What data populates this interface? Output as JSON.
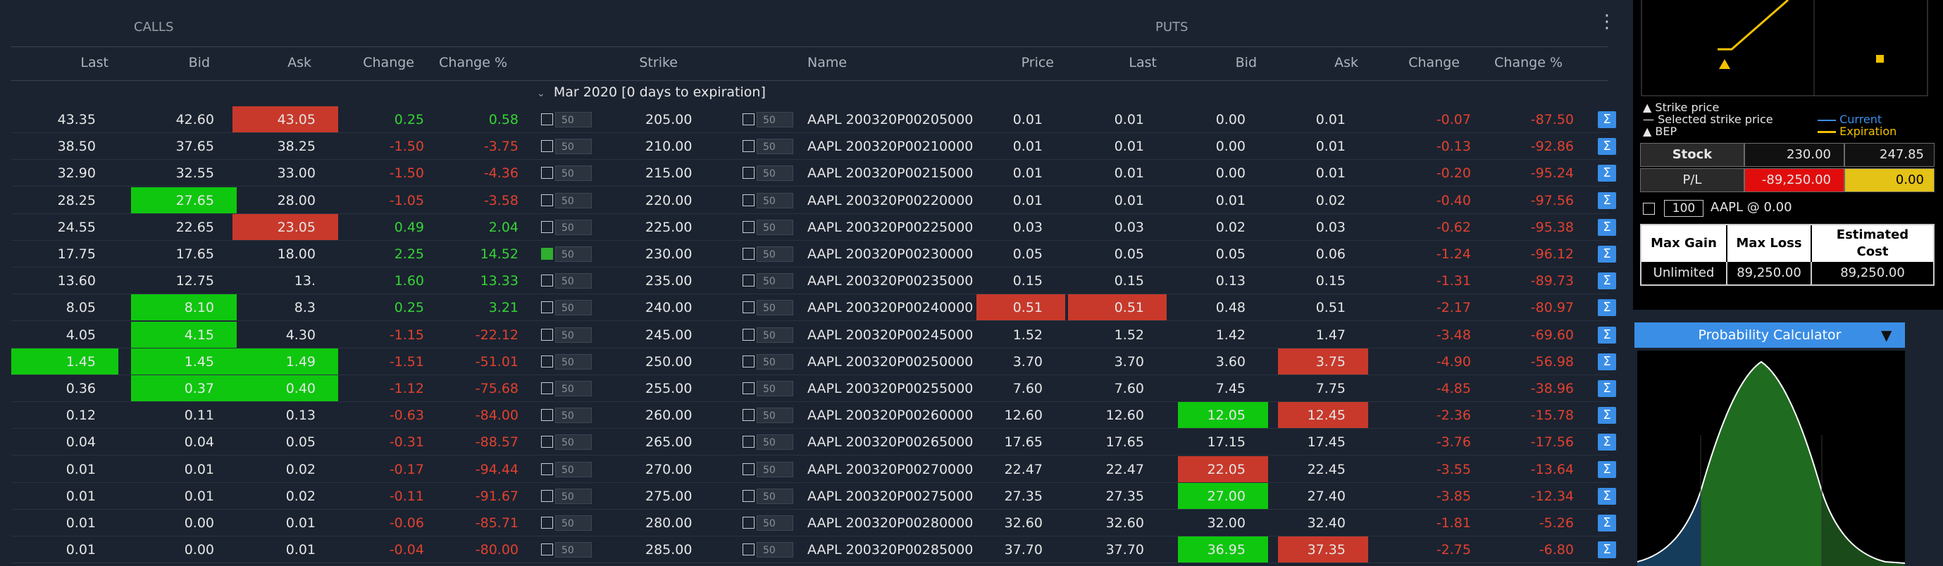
{
  "sections": {
    "calls": "CALLS",
    "puts": "PUTS"
  },
  "headers": {
    "calls_last": "Last",
    "calls_bid": "Bid",
    "calls_ask": "Ask",
    "calls_change": "Change",
    "calls_change_pct": "Change %",
    "strike": "Strike",
    "name": "Name",
    "price": "Price",
    "puts_last": "Last",
    "puts_bid": "Bid",
    "puts_ask": "Ask",
    "puts_change": "Change",
    "puts_change_pct": "Change %"
  },
  "expiry_group": "Mar 2020 [0 days to expiration]",
  "qty_default": "50",
  "sigma": "Σ",
  "rows": [
    {
      "c_last": "43.35",
      "c_bid": "42.60",
      "c_ask": "43.05",
      "c_chg": "0.25",
      "c_chgp": "0.58",
      "strike": "205.00",
      "name": "AAPL 200320P00205000",
      "price": "0.01",
      "p_last": "0.01",
      "p_bid": "0.00",
      "p_ask": "0.01",
      "p_chg": "-0.07",
      "p_chgp": "-87.50"
    },
    {
      "c_last": "38.50",
      "c_bid": "37.65",
      "c_ask": "38.25",
      "c_chg": "-1.50",
      "c_chgp": "-3.75",
      "strike": "210.00",
      "name": "AAPL 200320P00210000",
      "price": "0.01",
      "p_last": "0.01",
      "p_bid": "0.00",
      "p_ask": "0.01",
      "p_chg": "-0.13",
      "p_chgp": "-92.86"
    },
    {
      "c_last": "32.90",
      "c_bid": "32.55",
      "c_ask": "33.00",
      "c_chg": "-1.50",
      "c_chgp": "-4.36",
      "strike": "215.00",
      "name": "AAPL 200320P00215000",
      "price": "0.01",
      "p_last": "0.01",
      "p_bid": "0.00",
      "p_ask": "0.01",
      "p_chg": "-0.20",
      "p_chgp": "-95.24"
    },
    {
      "c_last": "28.25",
      "c_bid": "27.65",
      "c_ask": "28.00",
      "c_chg": "-1.05",
      "c_chgp": "-3.58",
      "strike": "220.00",
      "name": "AAPL 200320P00220000",
      "price": "0.01",
      "p_last": "0.01",
      "p_bid": "0.01",
      "p_ask": "0.02",
      "p_chg": "-0.40",
      "p_chgp": "-97.56"
    },
    {
      "c_last": "24.55",
      "c_bid": "22.65",
      "c_ask": "23.05",
      "c_chg": "0.49",
      "c_chgp": "2.04",
      "strike": "225.00",
      "name": "AAPL 200320P00225000",
      "price": "0.03",
      "p_last": "0.03",
      "p_bid": "0.02",
      "p_ask": "0.03",
      "p_chg": "-0.62",
      "p_chgp": "-95.38"
    },
    {
      "c_last": "17.75",
      "c_bid": "17.65",
      "c_ask": "18.00",
      "c_chg": "2.25",
      "c_chgp": "14.52",
      "strike": "230.00",
      "name": "AAPL 200320P00230000",
      "price": "0.05",
      "p_last": "0.05",
      "p_bid": "0.05",
      "p_ask": "0.06",
      "p_chg": "-1.24",
      "p_chgp": "-96.12"
    },
    {
      "c_last": "13.60",
      "c_bid": "12.75",
      "c_ask": "13.",
      "c_chg": "1.60",
      "c_chgp": "13.33",
      "strike": "235.00",
      "name": "AAPL 200320P00235000",
      "price": "0.15",
      "p_last": "0.15",
      "p_bid": "0.13",
      "p_ask": "0.15",
      "p_chg": "-1.31",
      "p_chgp": "-89.73"
    },
    {
      "c_last": "8.05",
      "c_bid": "8.10",
      "c_ask": "8.3",
      "c_chg": "0.25",
      "c_chgp": "3.21",
      "strike": "240.00",
      "name": "AAPL 200320P00240000",
      "price": "0.51",
      "p_last": "0.51",
      "p_bid": "0.48",
      "p_ask": "0.51",
      "p_chg": "-2.17",
      "p_chgp": "-80.97"
    },
    {
      "c_last": "4.05",
      "c_bid": "4.15",
      "c_ask": "4.30",
      "c_chg": "-1.15",
      "c_chgp": "-22.12",
      "strike": "245.00",
      "name": "AAPL 200320P00245000",
      "price": "1.52",
      "p_last": "1.52",
      "p_bid": "1.42",
      "p_ask": "1.47",
      "p_chg": "-3.48",
      "p_chgp": "-69.60"
    },
    {
      "c_last": "1.45",
      "c_bid": "1.45",
      "c_ask": "1.49",
      "c_chg": "-1.51",
      "c_chgp": "-51.01",
      "strike": "250.00",
      "name": "AAPL 200320P00250000",
      "price": "3.70",
      "p_last": "3.70",
      "p_bid": "3.60",
      "p_ask": "3.75",
      "p_chg": "-4.90",
      "p_chgp": "-56.98"
    },
    {
      "c_last": "0.36",
      "c_bid": "0.37",
      "c_ask": "0.40",
      "c_chg": "-1.12",
      "c_chgp": "-75.68",
      "strike": "255.00",
      "name": "AAPL 200320P00255000",
      "price": "7.60",
      "p_last": "7.60",
      "p_bid": "7.45",
      "p_ask": "7.75",
      "p_chg": "-4.85",
      "p_chgp": "-38.96"
    },
    {
      "c_last": "0.12",
      "c_bid": "0.11",
      "c_ask": "0.13",
      "c_chg": "-0.63",
      "c_chgp": "-84.00",
      "strike": "260.00",
      "name": "AAPL 200320P00260000",
      "price": "12.60",
      "p_last": "12.60",
      "p_bid": "12.05",
      "p_ask": "12.45",
      "p_chg": "-2.36",
      "p_chgp": "-15.78"
    },
    {
      "c_last": "0.04",
      "c_bid": "0.04",
      "c_ask": "0.05",
      "c_chg": "-0.31",
      "c_chgp": "-88.57",
      "strike": "265.00",
      "name": "AAPL 200320P00265000",
      "price": "17.65",
      "p_last": "17.65",
      "p_bid": "17.15",
      "p_ask": "17.45",
      "p_chg": "-3.76",
      "p_chgp": "-17.56"
    },
    {
      "c_last": "0.01",
      "c_bid": "0.01",
      "c_ask": "0.02",
      "c_chg": "-0.17",
      "c_chgp": "-94.44",
      "strike": "270.00",
      "name": "AAPL 200320P00270000",
      "price": "22.47",
      "p_last": "22.47",
      "p_bid": "22.05",
      "p_ask": "22.45",
      "p_chg": "-3.55",
      "p_chgp": "-13.64"
    },
    {
      "c_last": "0.01",
      "c_bid": "0.01",
      "c_ask": "0.02",
      "c_chg": "-0.11",
      "c_chgp": "-91.67",
      "strike": "275.00",
      "name": "AAPL 200320P00275000",
      "price": "27.35",
      "p_last": "27.35",
      "p_bid": "27.00",
      "p_ask": "27.40",
      "p_chg": "-3.85",
      "p_chgp": "-12.34"
    },
    {
      "c_last": "0.01",
      "c_bid": "0.00",
      "c_ask": "0.01",
      "c_chg": "-0.06",
      "c_chgp": "-85.71",
      "strike": "280.00",
      "name": "AAPL 200320P00280000",
      "price": "32.60",
      "p_last": "32.60",
      "p_bid": "32.00",
      "p_ask": "32.40",
      "p_chg": "-1.81",
      "p_chgp": "-5.26"
    },
    {
      "c_last": "0.01",
      "c_bid": "0.00",
      "c_ask": "0.01",
      "c_chg": "-0.04",
      "c_chgp": "-80.00",
      "strike": "285.00",
      "name": "AAPL 200320P00285000",
      "price": "37.70",
      "p_last": "37.70",
      "p_bid": "36.95",
      "p_ask": "37.35",
      "p_chg": "-2.75",
      "p_chgp": "-6.80"
    }
  ],
  "highlights": {
    "c_bid_green": [
      3,
      7,
      8,
      9,
      10
    ],
    "c_ask_red": [
      0,
      4
    ],
    "c_ask_green": [
      9,
      10
    ],
    "c_last_green": [
      9
    ],
    "c_chk_checked": [
      5
    ],
    "price_red": [
      7
    ],
    "p_last_red": [
      7
    ],
    "p_bid_green": [
      11,
      14,
      16
    ],
    "p_bid_red": [
      13
    ],
    "p_ask_red": [
      9,
      11,
      16
    ]
  },
  "colors": {
    "accent_blue": "#3a8ee6",
    "green": "#0fc70f",
    "red": "#c8392b",
    "current": "#3a8ee6",
    "expiration": "#f2c200"
  },
  "payoff": {
    "legend_strike": "Strike price",
    "legend_selected": "Selected strike price",
    "legend_bep": "BEP",
    "legend_current": "Current",
    "legend_expiration": "Expiration",
    "stock_label": "Stock",
    "stock_val1": "230.00",
    "stock_val2": "247.85",
    "pl_label": "P/L",
    "pl_val1": "-89,250.00",
    "pl_val2": "0.00",
    "qty": "100",
    "underlying": "AAPL @ 0.00",
    "th_max_gain": "Max Gain",
    "th_max_loss": "Max Loss",
    "th_est_cost": "Estimated Cost",
    "td_max_gain": "Unlimited",
    "td_max_loss": "89,250.00",
    "td_est_cost": "89,250.00"
  },
  "prob_calc": {
    "title": "Probability Calculator"
  }
}
